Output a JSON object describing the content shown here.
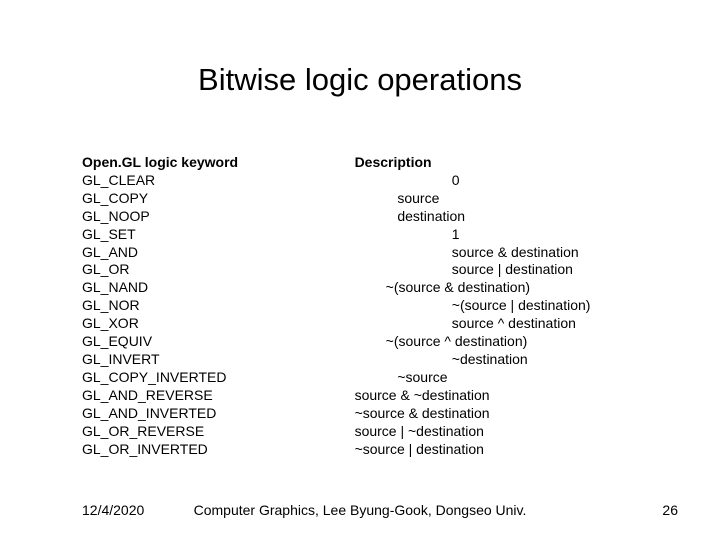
{
  "title": "Bitwise logic operations",
  "headers": {
    "col1": "Open.GL logic keyword",
    "col2": "Description"
  },
  "rows": [
    {
      "key": "GL_CLEAR",
      "desc": "                         0"
    },
    {
      "key": "GL_COPY",
      "desc": "           source"
    },
    {
      "key": "GL_NOOP",
      "desc": "           destination"
    },
    {
      "key": "GL_SET",
      "desc": "                         1"
    },
    {
      "key": "GL_AND",
      "desc": "                         source & destination"
    },
    {
      "key": "GL_OR",
      "desc": "                         source | destination"
    },
    {
      "key": "GL_NAND",
      "desc": "        ~(source & destination)"
    },
    {
      "key": "GL_NOR",
      "desc": "                         ~(source | destination)"
    },
    {
      "key": "GL_XOR",
      "desc": "                         source ^ destination"
    },
    {
      "key": "GL_EQUIV",
      "desc": "        ~(source ^ destination)"
    },
    {
      "key": "GL_INVERT",
      "desc": "                         ~destination"
    },
    {
      "key": "GL_COPY_INVERTED",
      "desc": "           ~source"
    },
    {
      "key": "GL_AND_REVERSE",
      "desc": "source & ~destination"
    },
    {
      "key": "GL_AND_INVERTED",
      "desc": "~source & destination"
    },
    {
      "key": "GL_OR_REVERSE",
      "desc": "source | ~destination"
    },
    {
      "key": "GL_OR_INVERTED",
      "desc": "~source | destination"
    }
  ],
  "footer": {
    "date": "12/4/2020",
    "center": "Computer Graphics, Lee Byung-Gook, Dongseo Univ.",
    "page": "26"
  }
}
